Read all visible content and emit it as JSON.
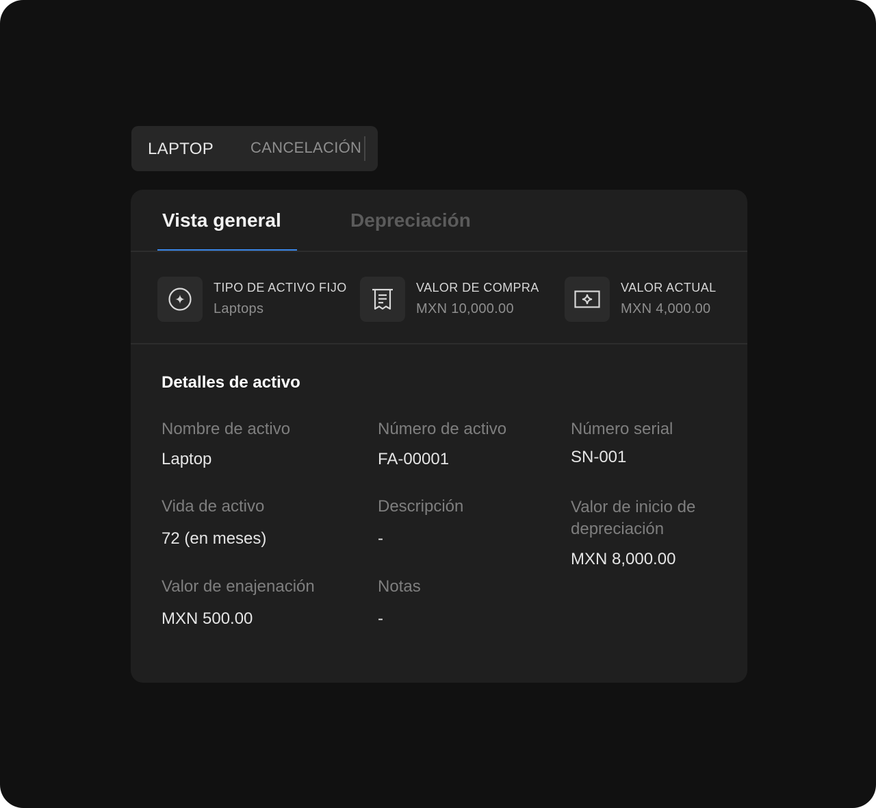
{
  "header": {
    "asset_name": "LAPTOP",
    "status": "CANCELACIÓN"
  },
  "tabs": [
    {
      "label": "Vista general",
      "active": true
    },
    {
      "label": "Depreciación",
      "active": false
    }
  ],
  "accent_color": "#3a86e8",
  "stats": [
    {
      "icon": "sparkle-circle-icon",
      "label": "TIPO DE ACTIVO FIJO",
      "value": "Laptops"
    },
    {
      "icon": "receipt-icon",
      "label": "VALOR DE COMPRA",
      "value": "MXN 10,000.00"
    },
    {
      "icon": "banknote-icon",
      "label": "VALOR ACTUAL",
      "value": "MXN 4,000.00"
    }
  ],
  "details": {
    "title": "Detalles de activo",
    "fields": [
      {
        "label": "Nombre de activo",
        "value": "Laptop"
      },
      {
        "label": "Número de activo",
        "value": "FA-00001"
      },
      {
        "label": "Número serial",
        "value": "SN-001"
      },
      {
        "label": "Vida de activo",
        "value": "72 (en meses)"
      },
      {
        "label": "Descripción",
        "value": "-"
      },
      {
        "label": "Valor de inicio de depreciación",
        "value": "MXN 8,000.00"
      },
      {
        "label": "Valor de enajenación",
        "value": "MXN 500.00"
      },
      {
        "label": "Notas",
        "value": "-"
      }
    ]
  }
}
